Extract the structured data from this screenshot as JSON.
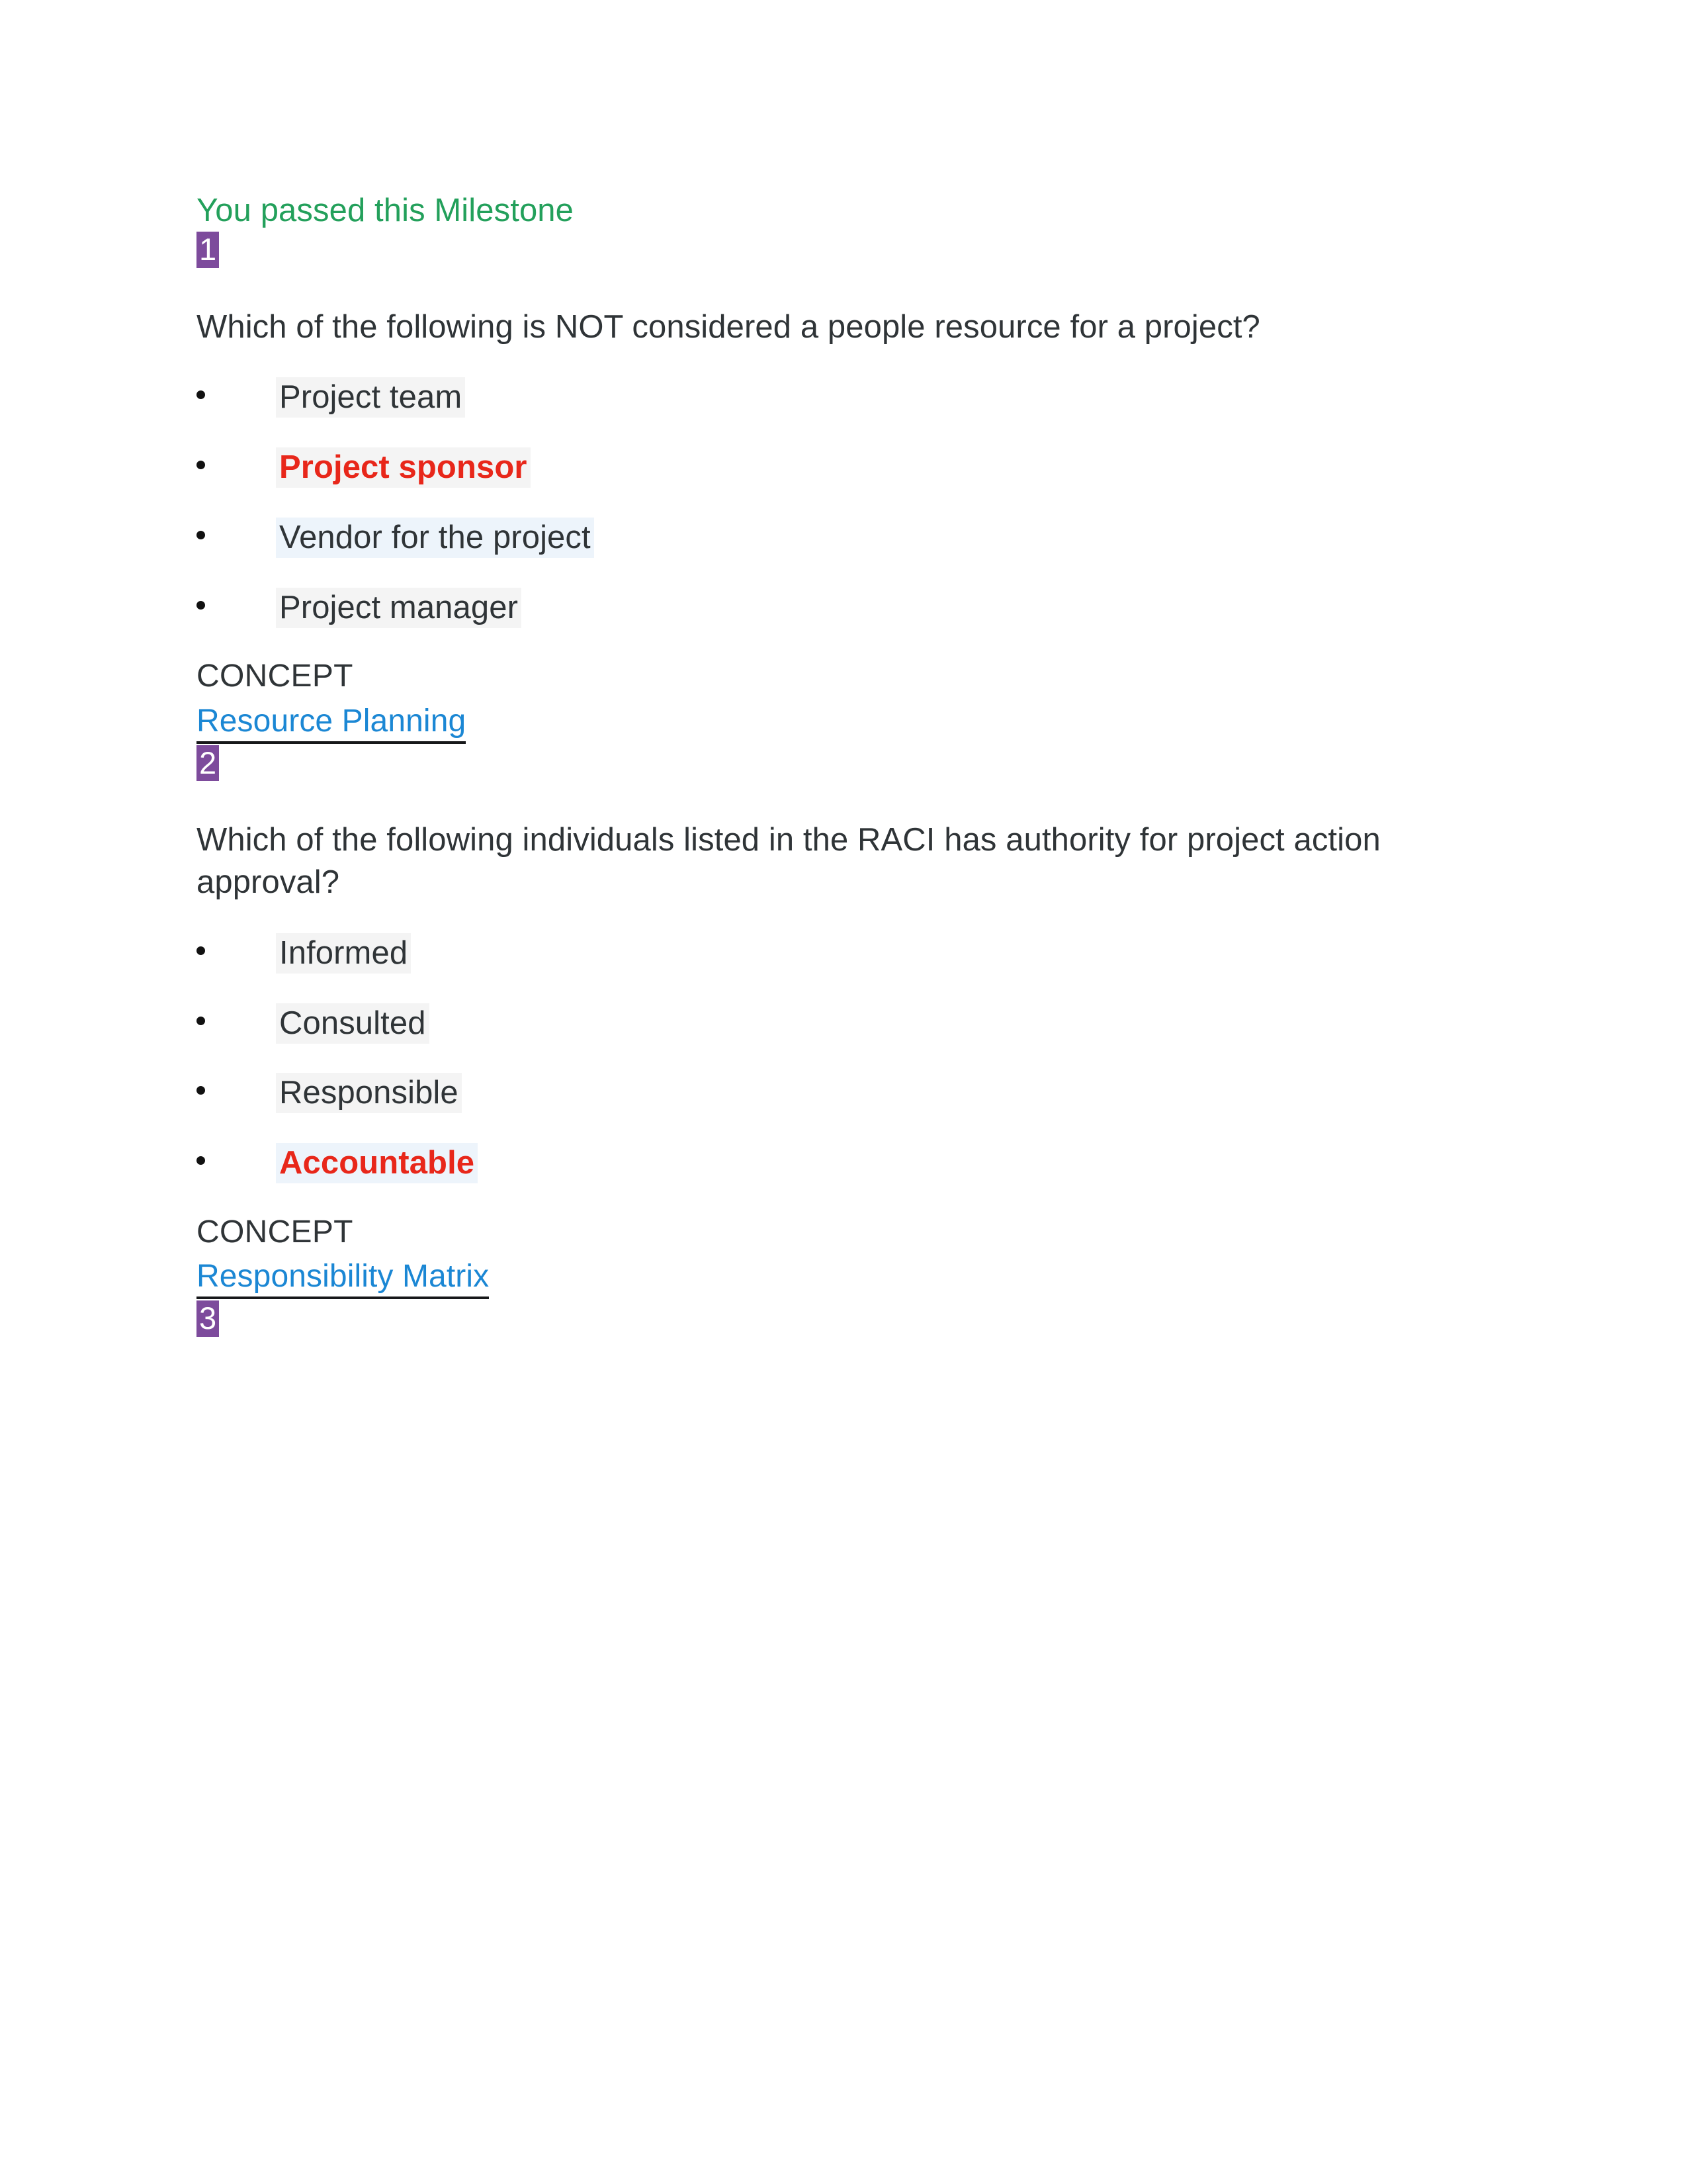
{
  "document": {
    "milestone_status": "You passed this Milestone",
    "concept_label": "CONCEPT"
  },
  "colors": {
    "pass_green": "#23a05b",
    "badge_purple": "#7d4b9c",
    "answer_red": "#e8271a",
    "link_blue": "#1b87d4",
    "highlight_gray": "#f4f4f4",
    "highlight_blue": "#edf4fb",
    "body_text": "#2f3437"
  },
  "questions": [
    {
      "number": "1",
      "prompt": "Which of the following is NOT considered a people resource for a project?",
      "options": [
        {
          "label": "Project team",
          "highlight": "gray",
          "is_answer": false
        },
        {
          "label": "Project sponsor",
          "highlight": "gray",
          "is_answer": true
        },
        {
          "label": "Vendor for the project",
          "highlight": "blue",
          "is_answer": false
        },
        {
          "label": "Project manager",
          "highlight": "gray",
          "is_answer": false
        }
      ],
      "concept_label": "CONCEPT",
      "concept_link": "Resource Planning"
    },
    {
      "number": "2",
      "prompt": "Which of the following individuals listed in the RACI has authority for project action approval?",
      "options": [
        {
          "label": "Informed",
          "highlight": "gray",
          "is_answer": false
        },
        {
          "label": "Consulted",
          "highlight": "gray",
          "is_answer": false
        },
        {
          "label": "Responsible",
          "highlight": "gray",
          "is_answer": false
        },
        {
          "label": "Accountable",
          "highlight": "blue",
          "is_answer": true
        }
      ],
      "concept_label": "CONCEPT",
      "concept_link": "Responsibility Matrix"
    },
    {
      "number": "3",
      "prompt": "",
      "options": [],
      "concept_label": "",
      "concept_link": ""
    }
  ]
}
